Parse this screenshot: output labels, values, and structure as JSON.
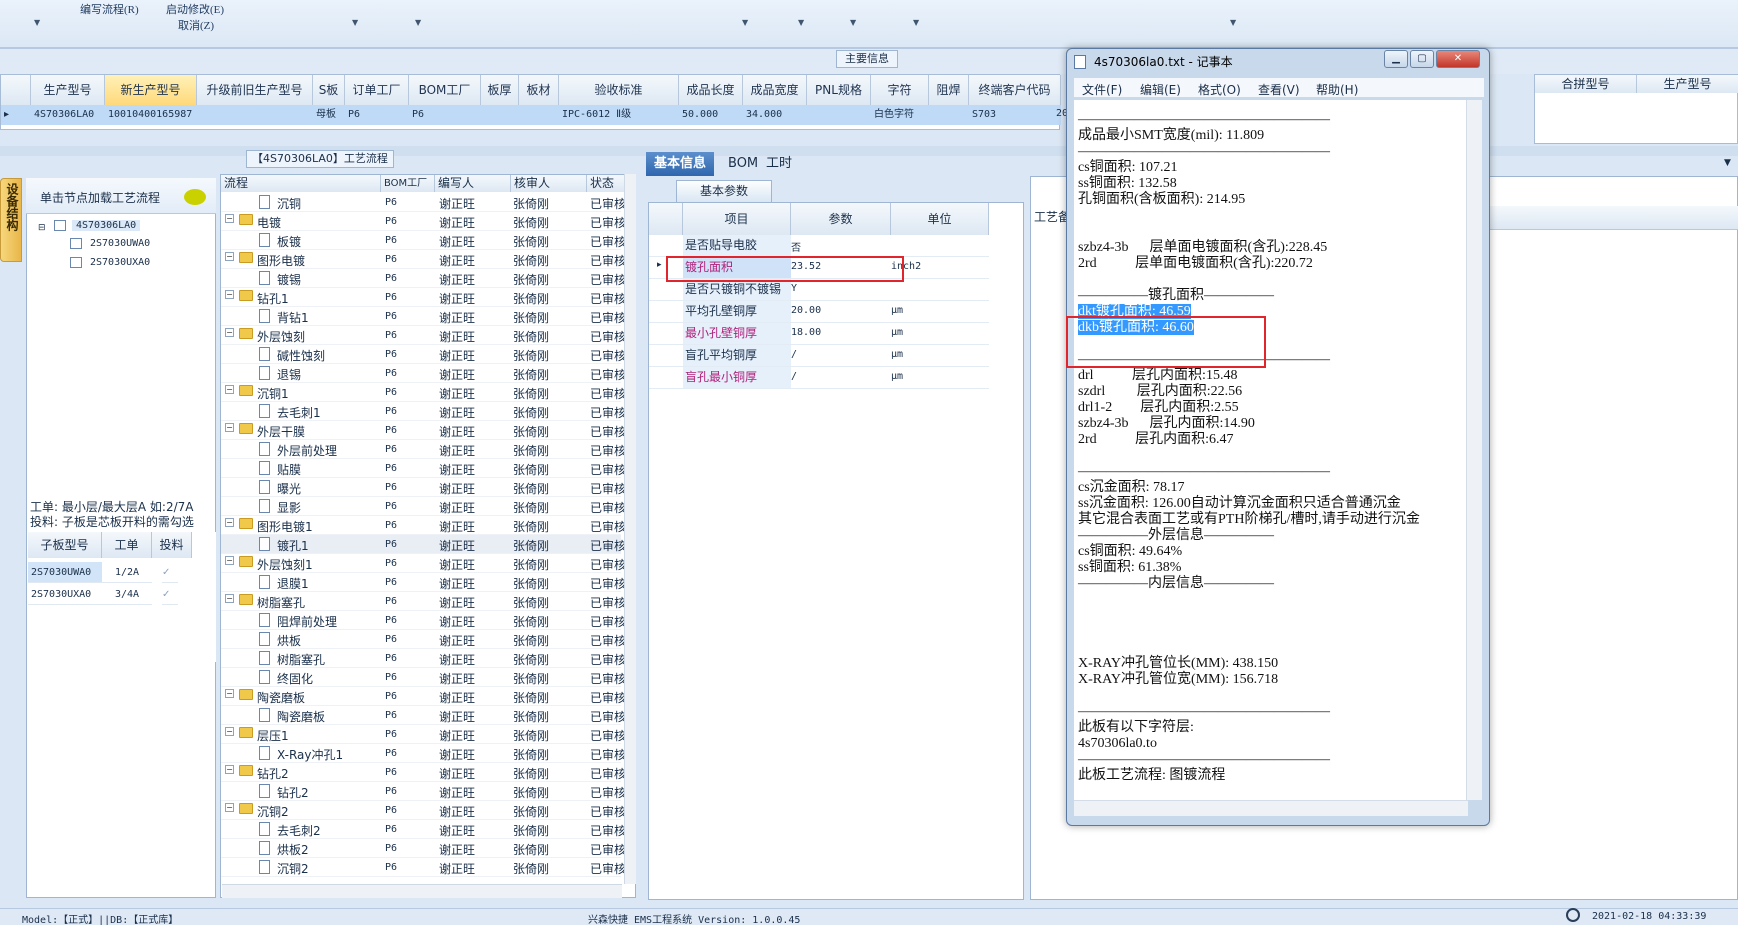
{
  "menu": {
    "edit_flow": "编写流程(R)",
    "start_modify": "启动修改(E)",
    "cancel": "取消(Z)"
  },
  "main_info_title": "主要信息",
  "grid": {
    "headers": [
      "生产型号",
      "新生产型号",
      "升级前旧生产型号",
      "S板",
      "订单工厂",
      "BOM工厂",
      "板厚",
      "板材",
      "验收标准",
      "成品长度",
      "成品宽度",
      "PNL规格",
      "字符",
      "阻焊",
      "终端客户代码"
    ],
    "row": [
      "4S70306LA0",
      "10010400165987",
      "",
      "母板",
      "P6",
      "P6",
      "",
      "",
      "IPC-6012 Ⅱ级",
      "50.000",
      "34.000",
      "",
      "白色字符",
      "",
      "S703"
    ],
    "row_extra": "20"
  },
  "grid_right": {
    "headers": [
      "合拼型号",
      "生产型号"
    ]
  },
  "flow_panel_title": "【4S70306LA0】工艺流程",
  "left_tab": "设备结构",
  "left_panel": {
    "header": "单击节点加载工艺流程",
    "tree": [
      "4S70306LA0",
      "2S7030UWA0",
      "2S7030UXA0"
    ],
    "note_line1": "工单: 最小层/最大层A 如:2/7A",
    "note_line2": "投料: 子板是芯板开料的需勾选",
    "table_headers": [
      "子板型号",
      "工单",
      "投料"
    ],
    "table_rows": [
      {
        "model": "2S7030UWA0",
        "order": "1/2A",
        "feed": "✓"
      },
      {
        "model": "2S7030UXA0",
        "order": "3/4A",
        "feed": "✓"
      }
    ]
  },
  "process_tree": {
    "headers": [
      "流程",
      "BOM工厂",
      "编写人",
      "核审人",
      "状态"
    ],
    "rows": [
      {
        "name": "沉铜",
        "bom": "P6",
        "writer": "谢正旺",
        "reviewer": "张倚刚",
        "status": "已审核",
        "kind": "doc"
      },
      {
        "name": "电镀",
        "bom": "P6",
        "writer": "谢正旺",
        "reviewer": "张倚刚",
        "status": "已审核",
        "kind": "folder"
      },
      {
        "name": "板镀",
        "bom": "P6",
        "writer": "谢正旺",
        "reviewer": "张倚刚",
        "status": "已审核",
        "kind": "doc"
      },
      {
        "name": "图形电镀",
        "bom": "P6",
        "writer": "谢正旺",
        "reviewer": "张倚刚",
        "status": "已审核",
        "kind": "folder"
      },
      {
        "name": "镀锡",
        "bom": "P6",
        "writer": "谢正旺",
        "reviewer": "张倚刚",
        "status": "已审核",
        "kind": "doc"
      },
      {
        "name": "钻孔1",
        "bom": "P6",
        "writer": "谢正旺",
        "reviewer": "张倚刚",
        "status": "已审核",
        "kind": "folder"
      },
      {
        "name": "背钻1",
        "bom": "P6",
        "writer": "谢正旺",
        "reviewer": "张倚刚",
        "status": "已审核",
        "kind": "doc"
      },
      {
        "name": "外层蚀刻",
        "bom": "P6",
        "writer": "谢正旺",
        "reviewer": "张倚刚",
        "status": "已审核",
        "kind": "folder"
      },
      {
        "name": "碱性蚀刻",
        "bom": "P6",
        "writer": "谢正旺",
        "reviewer": "张倚刚",
        "status": "已审核",
        "kind": "doc"
      },
      {
        "name": "退锡",
        "bom": "P6",
        "writer": "谢正旺",
        "reviewer": "张倚刚",
        "status": "已审核",
        "kind": "doc"
      },
      {
        "name": "沉铜1",
        "bom": "P6",
        "writer": "谢正旺",
        "reviewer": "张倚刚",
        "status": "已审核",
        "kind": "folder"
      },
      {
        "name": "去毛刺1",
        "bom": "P6",
        "writer": "谢正旺",
        "reviewer": "张倚刚",
        "status": "已审核",
        "kind": "doc"
      },
      {
        "name": "外层干膜",
        "bom": "P6",
        "writer": "谢正旺",
        "reviewer": "张倚刚",
        "status": "已审核",
        "kind": "folder"
      },
      {
        "name": "外层前处理",
        "bom": "P6",
        "writer": "谢正旺",
        "reviewer": "张倚刚",
        "status": "已审核",
        "kind": "doc"
      },
      {
        "name": "贴膜",
        "bom": "P6",
        "writer": "谢正旺",
        "reviewer": "张倚刚",
        "status": "已审核",
        "kind": "doc"
      },
      {
        "name": "曝光",
        "bom": "P6",
        "writer": "谢正旺",
        "reviewer": "张倚刚",
        "status": "已审核",
        "kind": "doc"
      },
      {
        "name": "显影",
        "bom": "P6",
        "writer": "谢正旺",
        "reviewer": "张倚刚",
        "status": "已审核",
        "kind": "doc"
      },
      {
        "name": "图形电镀1",
        "bom": "P6",
        "writer": "谢正旺",
        "reviewer": "张倚刚",
        "status": "已审核",
        "kind": "folder"
      },
      {
        "name": "镀孔1",
        "bom": "P6",
        "writer": "谢正旺",
        "reviewer": "张倚刚",
        "status": "已审核",
        "kind": "doc",
        "selected": true
      },
      {
        "name": "外层蚀刻1",
        "bom": "P6",
        "writer": "谢正旺",
        "reviewer": "张倚刚",
        "status": "已审核",
        "kind": "folder"
      },
      {
        "name": "退膜1",
        "bom": "P6",
        "writer": "谢正旺",
        "reviewer": "张倚刚",
        "status": "已审核",
        "kind": "doc"
      },
      {
        "name": "树脂塞孔",
        "bom": "P6",
        "writer": "谢正旺",
        "reviewer": "张倚刚",
        "status": "已审核",
        "kind": "folder"
      },
      {
        "name": "阻焊前处理",
        "bom": "P6",
        "writer": "谢正旺",
        "reviewer": "张倚刚",
        "status": "已审核",
        "kind": "doc"
      },
      {
        "name": "烘板",
        "bom": "P6",
        "writer": "谢正旺",
        "reviewer": "张倚刚",
        "status": "已审核",
        "kind": "doc"
      },
      {
        "name": "树脂塞孔",
        "bom": "P6",
        "writer": "谢正旺",
        "reviewer": "张倚刚",
        "status": "已审核",
        "kind": "doc"
      },
      {
        "name": "终固化",
        "bom": "P6",
        "writer": "谢正旺",
        "reviewer": "张倚刚",
        "status": "已审核",
        "kind": "doc"
      },
      {
        "name": "陶瓷磨板",
        "bom": "P6",
        "writer": "谢正旺",
        "reviewer": "张倚刚",
        "status": "已审核",
        "kind": "folder"
      },
      {
        "name": "陶瓷磨板",
        "bom": "P6",
        "writer": "谢正旺",
        "reviewer": "张倚刚",
        "status": "已审核",
        "kind": "doc"
      },
      {
        "name": "层压1",
        "bom": "P6",
        "writer": "谢正旺",
        "reviewer": "张倚刚",
        "status": "已审核",
        "kind": "folder"
      },
      {
        "name": "X-Ray冲孔1",
        "bom": "P6",
        "writer": "谢正旺",
        "reviewer": "张倚刚",
        "status": "已审核",
        "kind": "doc"
      },
      {
        "name": "钻孔2",
        "bom": "P6",
        "writer": "谢正旺",
        "reviewer": "张倚刚",
        "status": "已审核",
        "kind": "folder"
      },
      {
        "name": "钻孔2",
        "bom": "P6",
        "writer": "谢正旺",
        "reviewer": "张倚刚",
        "status": "已审核",
        "kind": "doc"
      },
      {
        "name": "沉铜2",
        "bom": "P6",
        "writer": "谢正旺",
        "reviewer": "张倚刚",
        "status": "已审核",
        "kind": "folder"
      },
      {
        "name": "去毛刺2",
        "bom": "P6",
        "writer": "谢正旺",
        "reviewer": "张倚刚",
        "status": "已审核",
        "kind": "doc"
      },
      {
        "name": "烘板2",
        "bom": "P6",
        "writer": "谢正旺",
        "reviewer": "张倚刚",
        "status": "已审核",
        "kind": "doc"
      },
      {
        "name": "沉铜2",
        "bom": "P6",
        "writer": "谢正旺",
        "reviewer": "张倚刚",
        "status": "已审核",
        "kind": "doc"
      }
    ]
  },
  "info_tabs": [
    "基本信息",
    "BOM",
    "工时"
  ],
  "sub_tab": "基本参数",
  "params": {
    "headers": [
      "项目",
      "参数",
      "单位"
    ],
    "rows": [
      {
        "item": "是否贴导电胶",
        "value": "否",
        "unit": "",
        "pink": false
      },
      {
        "item": "镀孔面积",
        "value": "23.52",
        "unit": "inch2",
        "pink": true
      },
      {
        "item": "是否只镀铜不镀锡",
        "value": "Y",
        "unit": "",
        "pink": false
      },
      {
        "item": "平均孔壁铜厚",
        "value": "20.00",
        "unit": "μm",
        "pink": false
      },
      {
        "item": "最小孔壁铜厚",
        "value": "18.00",
        "unit": "μm",
        "pink": true
      },
      {
        "item": "盲孔平均铜厚",
        "value": "/",
        "unit": "μm",
        "pink": false
      },
      {
        "item": "盲孔最小铜厚",
        "value": "/",
        "unit": "μm",
        "pink": true
      }
    ]
  },
  "right_panel_title": "工艺备",
  "notepad": {
    "title": "4s70306la0.txt - 记事本",
    "menu": [
      "文件(F)",
      "编辑(E)",
      "格式(O)",
      "查看(V)",
      "帮助(H)"
    ],
    "lines_before": "——————————————————\n成品最小SMT宽度(mil): 11.809\n——————————————————\ncs铜面积: 107.21\nss铜面积: 132.58\n孔铜面积(含板面积): 214.95\n\n\nszbz4-3b      层单面电镀面积(含孔):228.45\n2rd           层单面电镀面积(含孔):220.72\n\n—————镀孔面积—————\n",
    "selected_lines": "dkt镀孔面积: 46.59\ndkb镀孔面积: 46.60",
    "lines_after": "\n\n——————————————————\ndrl           层孔内面积:15.48\nszdrl         层孔内面积:22.56\ndrl1-2        层孔内面积:2.55\nszbz4-3b      层孔内面积:14.90\n2rd           层孔内面积:6.47\n\n——————————————————\ncs沉金面积: 78.17\nss沉金面积: 126.00自动计算沉金面积只适合普通沉金\n其它混合表面工艺或有PTH阶梯孔/槽时,请手动进行沉金\n—————外层信息—————\ncs铜面积: 49.64%\nss铜面积: 61.38%\n—————内层信息—————\n\n\n\n\nX-RAY冲孔管位长(MM): 438.150\nX-RAY冲孔管位宽(MM): 156.718\n\n——————————————————\n此板有以下字符层:\n4s70306la0.to\n——————————————————\n此板工艺流程: 图镀流程"
  },
  "status": {
    "model": "Model:【正式】||DB:【正式库】",
    "system": "兴森快捷 EMS工程系统 Version: 1.0.0.45",
    "datetime": "2021-02-18 04:33:39"
  }
}
